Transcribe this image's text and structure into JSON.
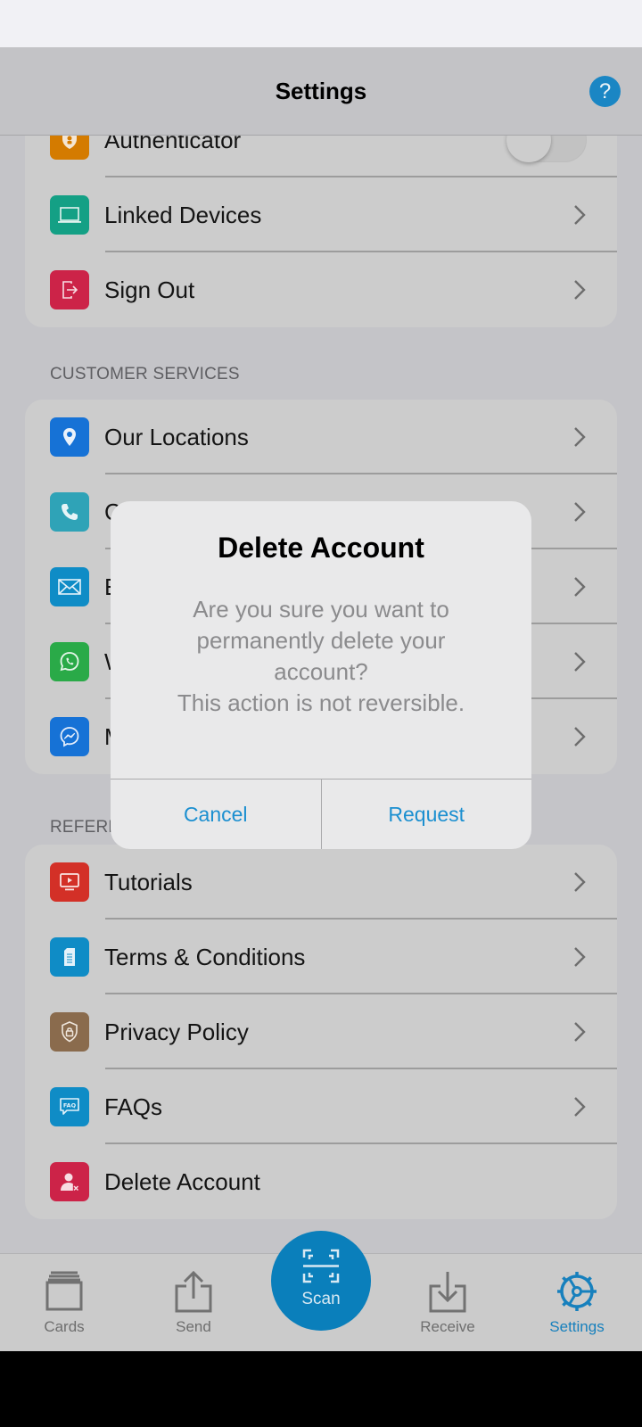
{
  "header": {
    "title": "Settings",
    "help_icon": "?"
  },
  "sections": {
    "account": {
      "items": [
        {
          "label": "Authenticator",
          "icon": "shield-user-icon",
          "color": "#d47b00",
          "type": "toggle",
          "toggle_on": false
        },
        {
          "label": "Linked Devices",
          "icon": "laptop-icon",
          "color": "#14a085",
          "type": "link"
        },
        {
          "label": "Sign Out",
          "icon": "sign-out-icon",
          "color": "#cc2348",
          "type": "link"
        }
      ]
    },
    "customer_services": {
      "title": "CUSTOMER SERVICES",
      "items": [
        {
          "label": "Our Locations",
          "icon": "location-pin-icon",
          "color": "#1672d6"
        },
        {
          "label": "C",
          "icon": "phone-icon",
          "color": "#2fa3b7"
        },
        {
          "label": "E",
          "icon": "mail-icon",
          "color": "#0f8cc6"
        },
        {
          "label": "W",
          "icon": "whatsapp-icon",
          "color": "#2aaa48"
        },
        {
          "label": "M",
          "icon": "messenger-icon",
          "color": "#1672d6"
        }
      ]
    },
    "reference": {
      "title": "REFERE",
      "items": [
        {
          "label": "Tutorials",
          "icon": "tutorial-screen-icon",
          "color": "#d33027",
          "type": "link"
        },
        {
          "label": "Terms & Conditions",
          "icon": "document-icon",
          "color": "#0f8cc6",
          "type": "link"
        },
        {
          "label": "Privacy Policy",
          "icon": "lock-shield-icon",
          "color": "#8a6b4d",
          "type": "link"
        },
        {
          "label": "FAQs",
          "icon": "faq-bubble-icon",
          "color": "#0f8cc6",
          "type": "link"
        },
        {
          "label": "Delete Account",
          "icon": "delete-user-icon",
          "color": "#cc2348",
          "type": "plain"
        }
      ]
    }
  },
  "dialog": {
    "title": "Delete Account",
    "message_lines": [
      "Are you sure you want to",
      "permanently delete your",
      "account?",
      "This action is not reversible."
    ],
    "cancel_label": "Cancel",
    "confirm_label": "Request"
  },
  "tabbar": {
    "tabs": [
      {
        "label": "Cards",
        "icon": "cards-icon",
        "active": false
      },
      {
        "label": "Send",
        "icon": "send-icon",
        "active": false
      },
      {
        "label": "Scan",
        "icon": "scan-icon",
        "active": false
      },
      {
        "label": "Receive",
        "icon": "receive-icon",
        "active": false
      },
      {
        "label": "Settings",
        "icon": "settings-gear-icon",
        "active": true
      }
    ]
  },
  "colors": {
    "accent": "#1a86c4",
    "overlay_background": "#c4c4c8",
    "card_background": "#cccccc"
  }
}
